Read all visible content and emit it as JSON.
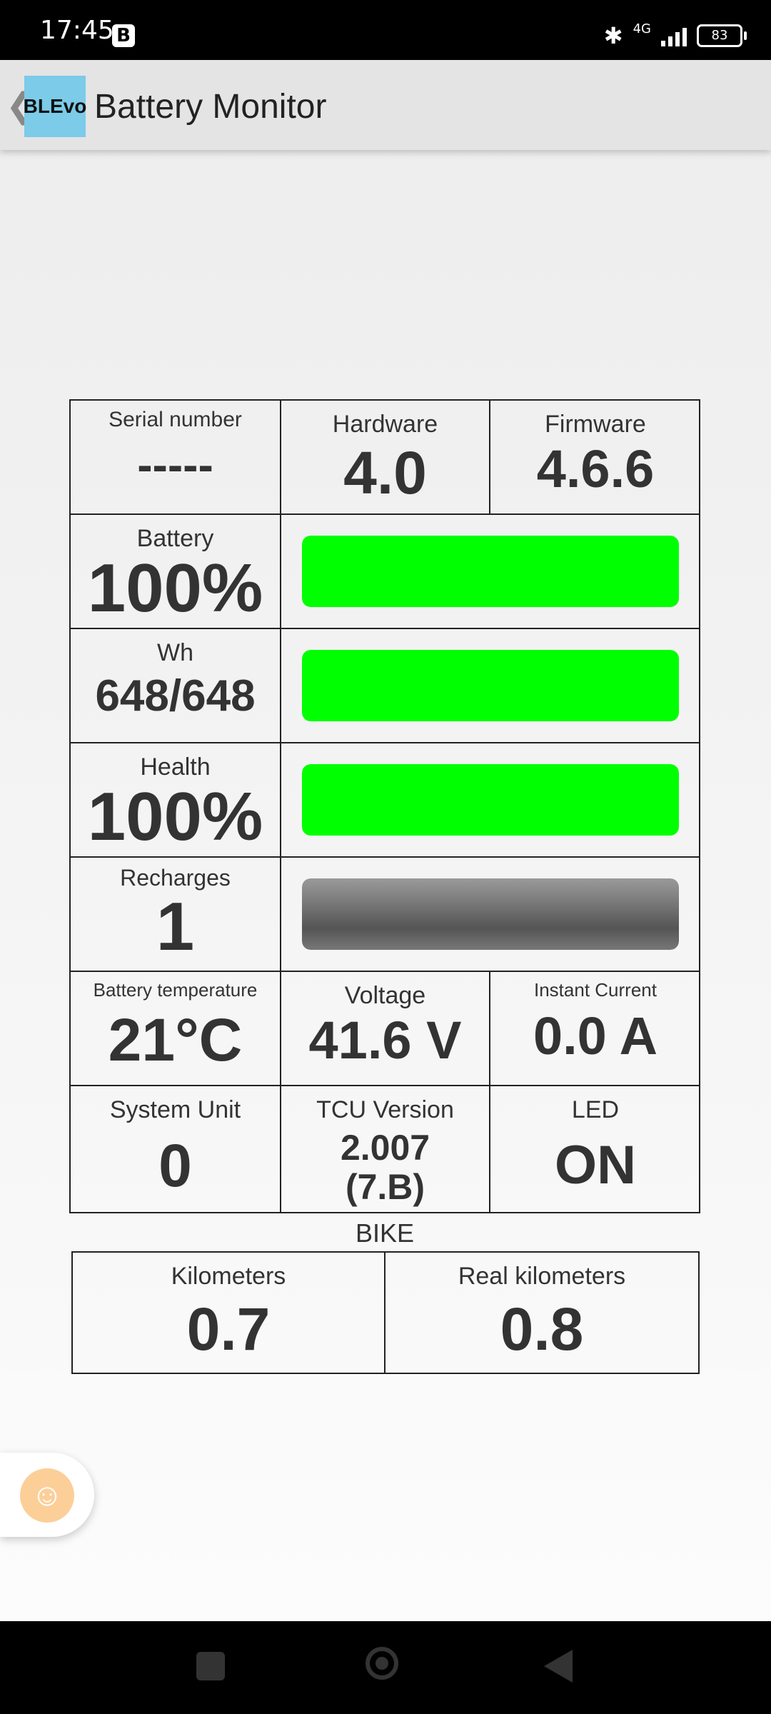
{
  "status_bar": {
    "time": "17:45",
    "notification_badge": "B",
    "network": "4G",
    "battery_level": "83"
  },
  "app_bar": {
    "logo_text": "BLEvo",
    "title": "Battery Monitor"
  },
  "grid": {
    "serial": {
      "label": "Serial number",
      "value": "-----"
    },
    "hardware": {
      "label": "Hardware",
      "value": "4.0"
    },
    "firmware": {
      "label": "Firmware",
      "value": "4.6.6"
    },
    "battery": {
      "label": "Battery",
      "value": "100%",
      "fill_percent": 100,
      "color": "#00ff00"
    },
    "wh": {
      "label": "Wh",
      "value": "648/648",
      "fill_percent": 100,
      "color": "#00ff00"
    },
    "health": {
      "label": "Health",
      "value": "100%",
      "fill_percent": 100,
      "color": "#00ff00"
    },
    "recharges": {
      "label": "Recharges",
      "value": "1",
      "fill_percent": 100,
      "color": "gray-gradient"
    },
    "temperature": {
      "label": "Battery temperature",
      "value": "21°C"
    },
    "voltage": {
      "label": "Voltage",
      "value": "41.6 V"
    },
    "current": {
      "label": "Instant Current",
      "value": "0.0 A"
    },
    "system_unit": {
      "label": "System Unit",
      "value": "0"
    },
    "tcu": {
      "label": "TCU Version",
      "value_line1": "2.007",
      "value_line2": "(7.B)"
    },
    "led": {
      "label": "LED",
      "value": "ON"
    }
  },
  "bike": {
    "title": "BIKE",
    "kilometers": {
      "label": "Kilometers",
      "value": "0.7"
    },
    "real_kilometers": {
      "label": "Real kilometers",
      "value": "0.8"
    }
  },
  "icons": {
    "bluetooth": "bluetooth-icon",
    "signal": "signal-icon",
    "battery": "battery-icon",
    "accessibility": "accessibility-icon",
    "back": "chevron-left-icon"
  }
}
